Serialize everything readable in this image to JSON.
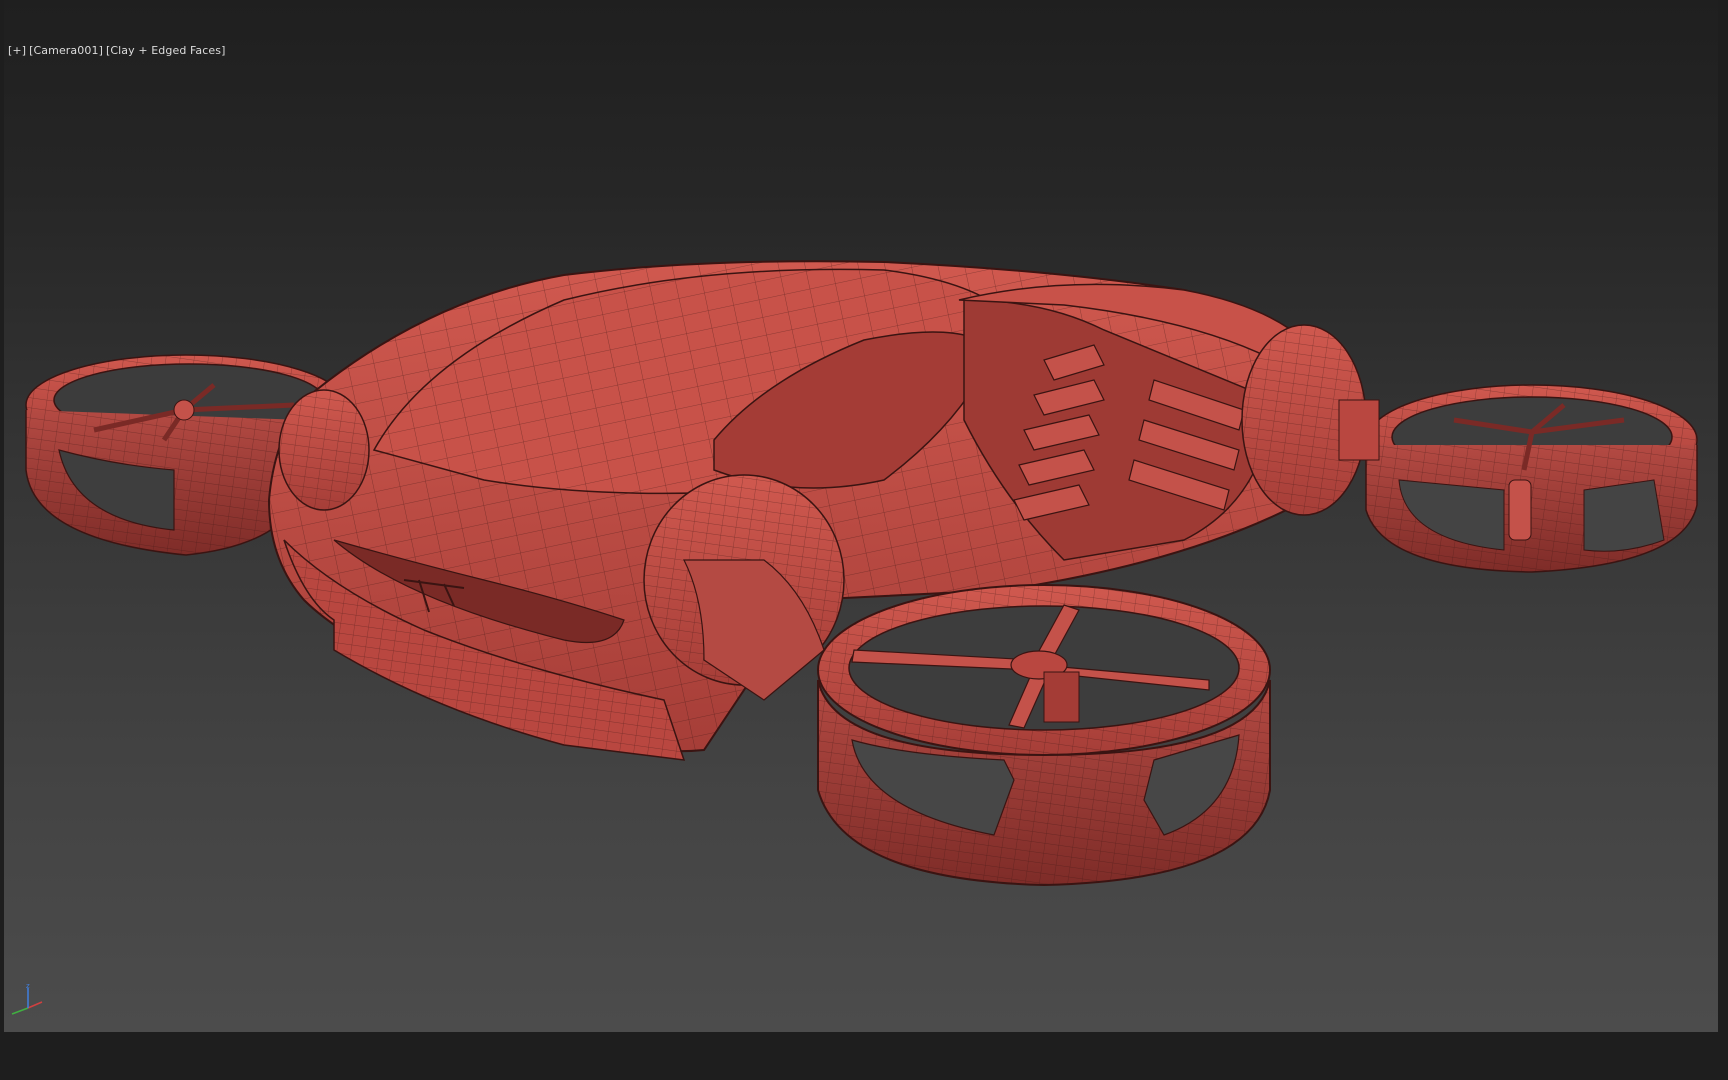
{
  "viewport": {
    "label_plus": "[+]",
    "label_camera": "[Camera001]",
    "label_shading": "[Clay + Edged Faces]"
  },
  "scene": {
    "subject": "drone-car",
    "clay_color": "#c4524a",
    "edge_color": "#3a1412",
    "shadow_color": "#7a2a26"
  },
  "gizmo": {
    "z": "z",
    "colors": {
      "x": "#d04040",
      "y": "#40b040",
      "z": "#4080e0"
    }
  }
}
